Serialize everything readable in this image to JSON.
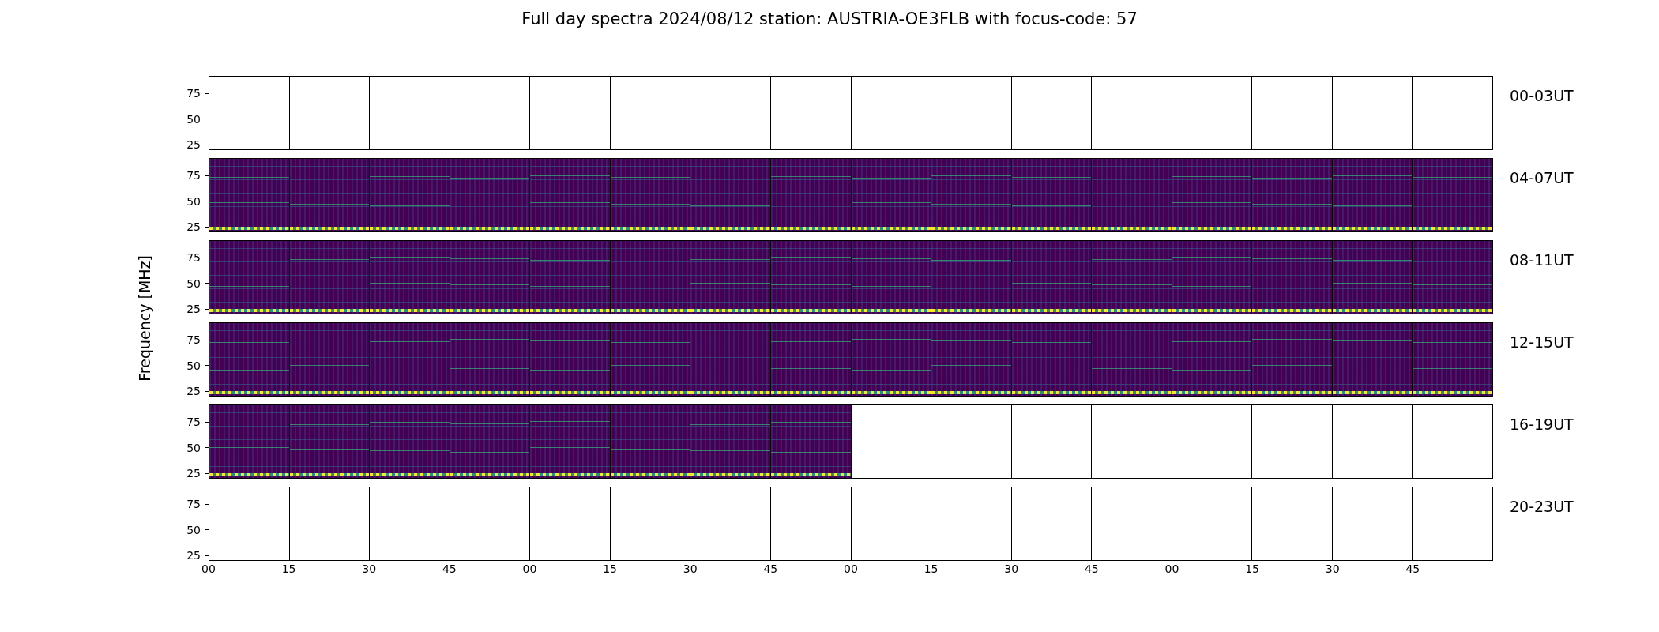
{
  "title": "Full day spectra 2024/08/12 station: AUSTRIA-OE3FLB with focus-code: 57",
  "ylabel": "Frequency [MHz]",
  "xticks": [
    "00",
    "15",
    "30",
    "45",
    "00",
    "15",
    "30",
    "45",
    "00",
    "15",
    "30",
    "45",
    "00",
    "15",
    "30",
    "45"
  ],
  "rows": [
    {
      "label": "00-03UT",
      "yticks": [
        "75",
        "50",
        "25"
      ],
      "panels": [
        {
          "data": false
        },
        {
          "data": false
        },
        {
          "data": false
        },
        {
          "data": false
        },
        {
          "data": false
        },
        {
          "data": false
        },
        {
          "data": false
        },
        {
          "data": false
        },
        {
          "data": false
        },
        {
          "data": false
        },
        {
          "data": false
        },
        {
          "data": false
        },
        {
          "data": false
        },
        {
          "data": false
        },
        {
          "data": false
        },
        {
          "data": false
        }
      ]
    },
    {
      "label": "04-07UT",
      "yticks": [
        "75",
        "50",
        "25"
      ],
      "panels": [
        {
          "data": true
        },
        {
          "data": true
        },
        {
          "data": true
        },
        {
          "data": true
        },
        {
          "data": true
        },
        {
          "data": true
        },
        {
          "data": true
        },
        {
          "data": true
        },
        {
          "data": true
        },
        {
          "data": true
        },
        {
          "data": true
        },
        {
          "data": true
        },
        {
          "data": true
        },
        {
          "data": true
        },
        {
          "data": true
        },
        {
          "data": true
        }
      ]
    },
    {
      "label": "08-11UT",
      "yticks": [
        "75",
        "50",
        "25"
      ],
      "panels": [
        {
          "data": true
        },
        {
          "data": true
        },
        {
          "data": true
        },
        {
          "data": true
        },
        {
          "data": true
        },
        {
          "data": true
        },
        {
          "data": true
        },
        {
          "data": true
        },
        {
          "data": true
        },
        {
          "data": true
        },
        {
          "data": true
        },
        {
          "data": true
        },
        {
          "data": true
        },
        {
          "data": true
        },
        {
          "data": true
        },
        {
          "data": true
        }
      ]
    },
    {
      "label": "12-15UT",
      "yticks": [
        "75",
        "50",
        "25"
      ],
      "panels": [
        {
          "data": true
        },
        {
          "data": true
        },
        {
          "data": true
        },
        {
          "data": true
        },
        {
          "data": true
        },
        {
          "data": true
        },
        {
          "data": true
        },
        {
          "data": true
        },
        {
          "data": true
        },
        {
          "data": true
        },
        {
          "data": true
        },
        {
          "data": true
        },
        {
          "data": true
        },
        {
          "data": true
        },
        {
          "data": true
        },
        {
          "data": true
        }
      ]
    },
    {
      "label": "16-19UT",
      "yticks": [
        "75",
        "50",
        "25"
      ],
      "panels": [
        {
          "data": true
        },
        {
          "data": true
        },
        {
          "data": true
        },
        {
          "data": true
        },
        {
          "data": true
        },
        {
          "data": true
        },
        {
          "data": true
        },
        {
          "data": true
        },
        {
          "data": false
        },
        {
          "data": false
        },
        {
          "data": false
        },
        {
          "data": false
        },
        {
          "data": false
        },
        {
          "data": false
        },
        {
          "data": false
        },
        {
          "data": false
        }
      ]
    },
    {
      "label": "20-23UT",
      "yticks": [
        "75",
        "50",
        "25"
      ],
      "panels": [
        {
          "data": false
        },
        {
          "data": false
        },
        {
          "data": false
        },
        {
          "data": false
        },
        {
          "data": false
        },
        {
          "data": false
        },
        {
          "data": false
        },
        {
          "data": false
        },
        {
          "data": false
        },
        {
          "data": false
        },
        {
          "data": false
        },
        {
          "data": false
        },
        {
          "data": false
        },
        {
          "data": false
        },
        {
          "data": false
        },
        {
          "data": false
        }
      ]
    }
  ]
}
